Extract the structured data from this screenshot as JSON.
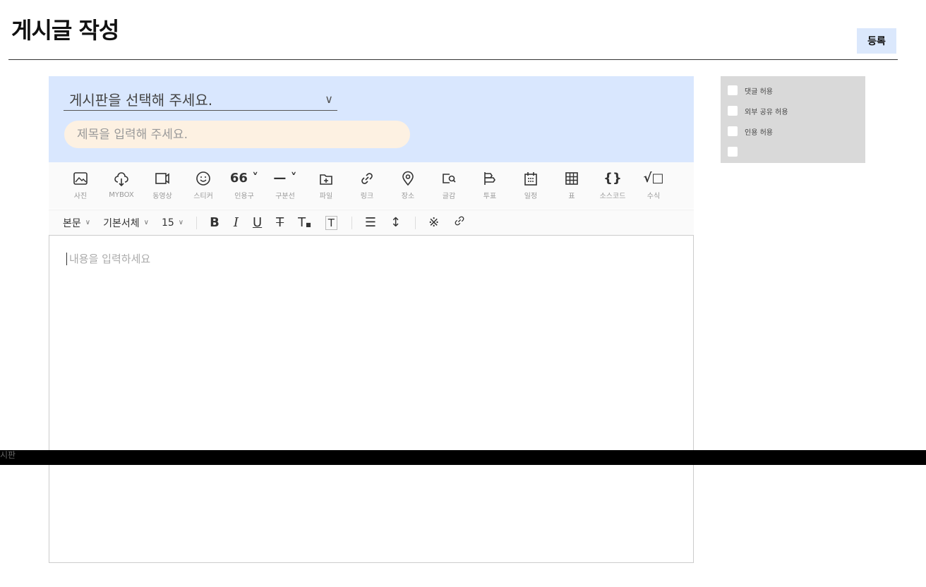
{
  "header": {
    "title": "게시글 작성",
    "register_label": "등록"
  },
  "board_select": {
    "label": "게시판을 선택해 주세요.",
    "arrow": "∨"
  },
  "title_input": {
    "placeholder": "제목을 입력해 주세요."
  },
  "toolbar": {
    "items": [
      {
        "label": "사진",
        "icon": "image-icon"
      },
      {
        "label": "MYBOX",
        "icon": "cloud-download-icon"
      },
      {
        "label": "동영상",
        "icon": "video-icon"
      },
      {
        "label": "스티커",
        "icon": "smile-icon"
      },
      {
        "label": "인용구",
        "icon": "quote-icon",
        "glyph": "66 ˅"
      },
      {
        "label": "구분선",
        "icon": "divider-icon",
        "glyph": "— ˅"
      },
      {
        "label": "파일",
        "icon": "file-add-icon"
      },
      {
        "label": "링크",
        "icon": "link-icon"
      },
      {
        "label": "장소",
        "icon": "location-icon"
      },
      {
        "label": "글감",
        "icon": "search-content-icon"
      },
      {
        "label": "투표",
        "icon": "vote-icon"
      },
      {
        "label": "일정",
        "icon": "calendar-icon"
      },
      {
        "label": "표",
        "icon": "table-icon"
      },
      {
        "label": "소스코드",
        "icon": "code-icon",
        "glyph": "{}"
      },
      {
        "label": "수식",
        "icon": "formula-icon",
        "glyph": "√□"
      }
    ]
  },
  "format_bar": {
    "paragraph": "본문",
    "font": "기본서체",
    "size": "15",
    "bold": "B",
    "italic": "I",
    "underline": "U",
    "strike": "T",
    "text_color": "T",
    "bg_color": "T",
    "align": "☰",
    "line_height": "↕",
    "special": "※",
    "link": "🔗"
  },
  "editor": {
    "placeholder": "내용을 입력하세요"
  },
  "band": {
    "text": "시판"
  },
  "options": [
    {
      "label": "댓글 허용"
    },
    {
      "label": "외부 공유 허용"
    },
    {
      "label": "인용 허용"
    },
    {
      "label": ""
    }
  ],
  "colors": {
    "panel_blue": "#d9e7fe",
    "title_input_bg": "#fdf1e2",
    "register_bg": "#dbe8fc",
    "options_bg": "#d9d9d9"
  }
}
